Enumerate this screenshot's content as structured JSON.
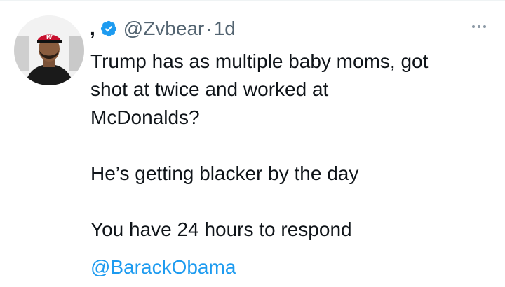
{
  "tweet": {
    "display_name": ",",
    "handle": "@Zvbear",
    "separator": "·",
    "time": "1d",
    "text": "Trump has as multiple baby moms, got\nshot at twice and worked at\nMcDonalds?\n\nHe’s getting blacker by the day\n\nYou have 24 hours to respond",
    "mention": "@BarackObama",
    "verified": true
  },
  "icons": {
    "verified": "verified-badge-icon",
    "more": "more-options-icon",
    "avatar": "profile-photo"
  },
  "colors": {
    "text": "#0f1419",
    "secondary": "#536471",
    "link": "#1d9bf0",
    "verified": "#1d9bf0"
  }
}
